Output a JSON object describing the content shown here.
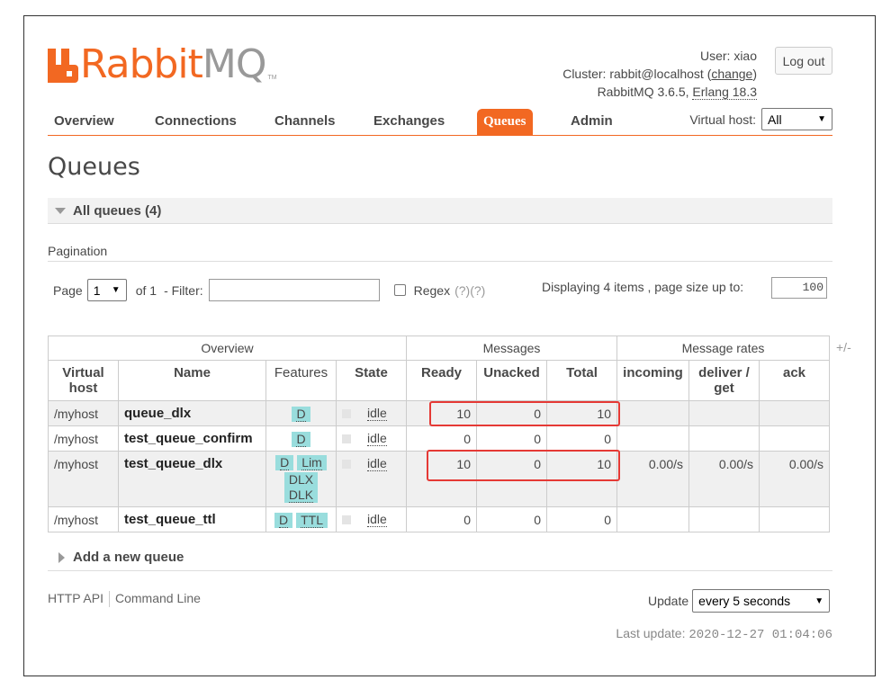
{
  "header": {
    "logo_rabbit": "Rabbit",
    "logo_mq": "MQ",
    "logo_tm": "TM",
    "user_label": "User:",
    "user": "xiao",
    "cluster_label": "Cluster:",
    "cluster": "rabbit@localhost",
    "change_link": "change",
    "version": "RabbitMQ 3.6.5,",
    "erlang": "Erlang 18.3",
    "logout": "Log out"
  },
  "nav": {
    "tabs": [
      "Overview",
      "Connections",
      "Channels",
      "Exchanges",
      "Queues",
      "Admin"
    ],
    "active": "Queues",
    "vhost_label": "Virtual host:",
    "vhost_value": "All"
  },
  "page": {
    "title": "Queues",
    "section": "All queues (4)",
    "pagination_label": "Pagination",
    "page_label": "Page",
    "page_value": "1",
    "of_label": "of 1",
    "filter_label": "- Filter:",
    "regex_label": "Regex",
    "regex_help": "(?)(?)",
    "displaying": "Displaying 4 items , page size up to:",
    "page_size": "100"
  },
  "table": {
    "groups": [
      "Overview",
      "Messages",
      "Message rates"
    ],
    "plusminus": "+/-",
    "columns": {
      "vhost": "Virtual host",
      "name": "Name",
      "features": "Features",
      "state": "State",
      "ready": "Ready",
      "unacked": "Unacked",
      "total": "Total",
      "incoming": "incoming",
      "deliver": "deliver / get",
      "ack": "ack"
    },
    "rows": [
      {
        "vhost": "/myhost",
        "name": "queue_dlx",
        "features": [
          "D"
        ],
        "state": "idle",
        "ready": "10",
        "unacked": "0",
        "total": "10",
        "incoming": "",
        "deliver": "",
        "ack": ""
      },
      {
        "vhost": "/myhost",
        "name": "test_queue_confirm",
        "features": [
          "D"
        ],
        "state": "idle",
        "ready": "0",
        "unacked": "0",
        "total": "0",
        "incoming": "",
        "deliver": "",
        "ack": ""
      },
      {
        "vhost": "/myhost",
        "name": "test_queue_dlx",
        "features": [
          "D",
          "Lim",
          "DLX",
          "DLK"
        ],
        "state": "idle",
        "ready": "10",
        "unacked": "0",
        "total": "10",
        "incoming": "0.00/s",
        "deliver": "0.00/s",
        "ack": "0.00/s"
      },
      {
        "vhost": "/myhost",
        "name": "test_queue_ttl",
        "features": [
          "D",
          "TTL"
        ],
        "state": "idle",
        "ready": "0",
        "unacked": "0",
        "total": "0",
        "incoming": "",
        "deliver": "",
        "ack": ""
      }
    ]
  },
  "footer": {
    "add_queue": "Add a new queue",
    "http_api": "HTTP API",
    "command_line": "Command Line",
    "update_label": "Update",
    "update_value": "every 5 seconds",
    "last_update_label": "Last update:",
    "last_update": "2020-12-27 01:04:06"
  },
  "colors": {
    "accent": "#f26822",
    "badge": "#99dddd",
    "highlight": "#e53935"
  }
}
